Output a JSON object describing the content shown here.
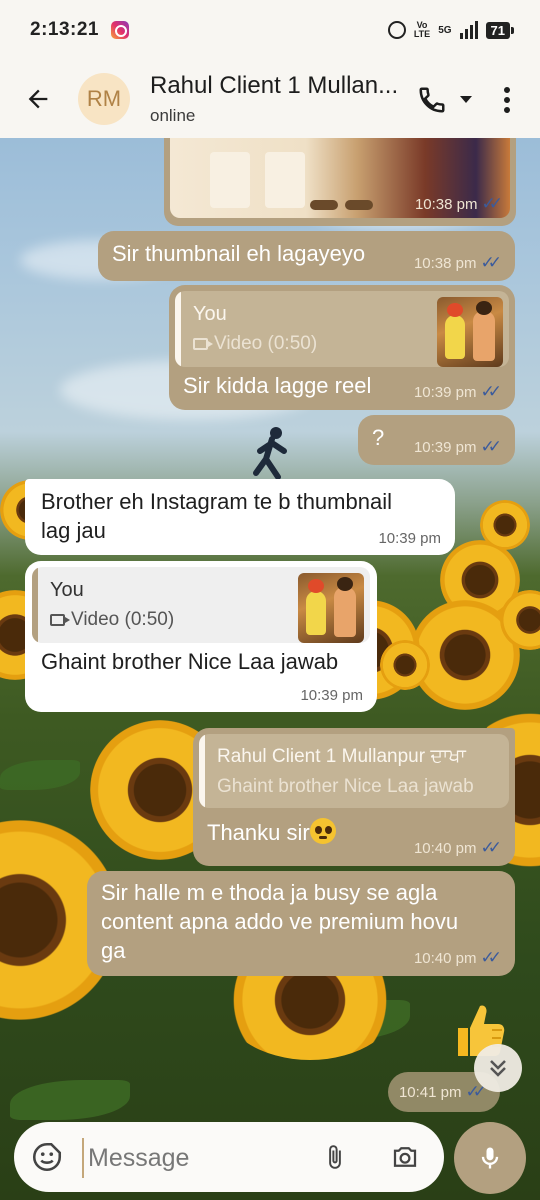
{
  "status_bar": {
    "time": "2:13:21",
    "network": "5G",
    "volte_top": "Vo",
    "volte_bottom": "LTE",
    "battery": "71"
  },
  "header": {
    "avatar_initials": "RM",
    "contact_name": "Rahul Client 1 Mullan...",
    "contact_status": "online",
    "back_icon": "arrow-left-icon",
    "call_icon": "phone-icon",
    "menu_icon": "more-vert-icon"
  },
  "messages": [
    {
      "type": "image",
      "direction": "out",
      "time": "10:38 pm",
      "read": true
    },
    {
      "type": "text",
      "direction": "out",
      "text": "Sir thumbnail eh lagayeyo",
      "time": "10:38 pm",
      "read": true
    },
    {
      "type": "reply",
      "direction": "out",
      "quote_author": "You",
      "quote_text": "Video (0:50)",
      "text": "Sir kidda lagge reel",
      "time": "10:39 pm",
      "read": true
    },
    {
      "type": "text",
      "direction": "out",
      "text": "?",
      "time": "10:39 pm",
      "read": true
    },
    {
      "type": "text",
      "direction": "in",
      "text_line1": "Brother eh Instagram te b thumbnail",
      "text_line2": "lag jau",
      "time": "10:39 pm"
    },
    {
      "type": "reply",
      "direction": "in",
      "quote_author": "You",
      "quote_text": "Video (0:50)",
      "text": "Ghaint brother Nice Laa jawab",
      "time": "10:39 pm"
    },
    {
      "type": "reply",
      "direction": "out",
      "quote_author": "Rahul Client 1 Mullanpur ਦਾਖਾ",
      "quote_text": "Ghaint brother Nice Laa jawab",
      "text": "Thanku sir",
      "emoji": "pleading-face",
      "time": "10:40 pm",
      "read": true
    },
    {
      "type": "text",
      "direction": "out",
      "text_line1": "Sir halle m e thoda ja busy se agla",
      "text_line2": "content apna addo ve premium hovu",
      "text_line3": "ga",
      "time": "10:40 pm",
      "read": true
    },
    {
      "type": "emoji",
      "direction": "out",
      "emoji": "thumbs-up",
      "time": "10:41 pm",
      "read": true
    }
  ],
  "input": {
    "placeholder": "Message"
  },
  "colors": {
    "outgoing_bubble": "#b3a080",
    "incoming_bubble": "#ffffff",
    "tick_read": "#3b5b9c",
    "header_bg": "#f8f6f2"
  }
}
